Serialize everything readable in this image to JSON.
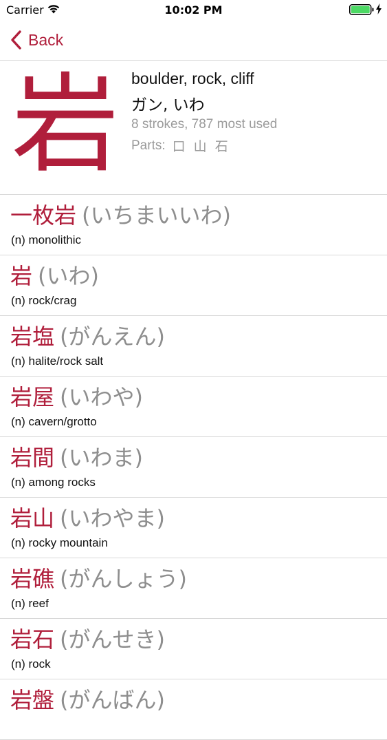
{
  "status_bar": {
    "carrier": "Carrier",
    "time": "10:02 PM"
  },
  "nav": {
    "back_label": "Back"
  },
  "kanji": {
    "character": "岩",
    "meanings": "boulder, rock, cliff",
    "readings": "ガン, いわ",
    "stats": "8 strokes, 787 most used",
    "parts_label": "Parts:",
    "parts": "口 山 石"
  },
  "words": [
    {
      "word": "一枚岩",
      "reading": "(いちまいいわ)",
      "definition": "(n) monolithic"
    },
    {
      "word": "岩",
      "reading": "(いわ)",
      "definition": "(n) rock/crag"
    },
    {
      "word": "岩塩",
      "reading": "(がんえん)",
      "definition": "(n) halite/rock salt"
    },
    {
      "word": "岩屋",
      "reading": "(いわや)",
      "definition": "(n) cavern/grotto"
    },
    {
      "word": "岩間",
      "reading": "(いわま)",
      "definition": "(n) among rocks"
    },
    {
      "word": "岩山",
      "reading": "(いわやま)",
      "definition": "(n) rocky mountain"
    },
    {
      "word": "岩礁",
      "reading": "(がんしょう)",
      "definition": "(n) reef"
    },
    {
      "word": "岩石",
      "reading": "(がんせき)",
      "definition": "(n) rock"
    },
    {
      "word": "岩盤",
      "reading": "(がんばん)",
      "definition": ""
    }
  ],
  "colors": {
    "accent": "#b01e3b",
    "secondary_text": "#8e8e8e",
    "separator": "#d8d8d8",
    "battery": "#4cd964"
  }
}
